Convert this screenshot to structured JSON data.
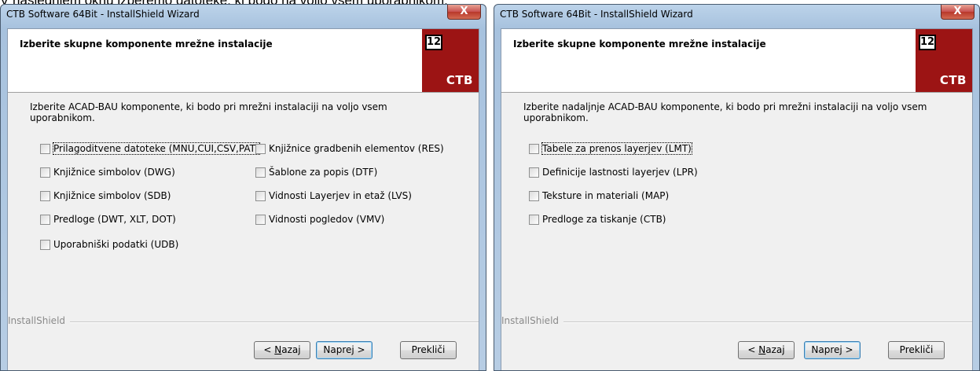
{
  "caption": "V naslednjem oknu izberemo datoteke, ki bodo na voljo vsem uporabnikom.",
  "windows": [
    {
      "title": "CTB Software 64Bit - InstallShield Wizard",
      "close_glyph": "X",
      "header_title": "Izberite skupne komponente mrežne instalacije",
      "logo_number": "12",
      "logo_text": "CTB",
      "description": "Izberite ACAD-BAU komponente, ki bodo pri mrežni instalaciji na voljo vsem uporabnikom.",
      "checkboxes": [
        {
          "label": "Prilagoditvene datoteke (MNU,CUI,CSV,PAT)",
          "checked": false,
          "focused": true
        },
        {
          "label": "Knjižnice simbolov (DWG)",
          "checked": false
        },
        {
          "label": "Knjižnice simbolov (SDB)",
          "checked": false
        },
        {
          "label": "Predloge (DWT, XLT, DOT)",
          "checked": false
        },
        {
          "label": "Uporabniški podatki (UDB)",
          "checked": false
        },
        {
          "label": "Knjižnice gradbenih elementov (RES)",
          "checked": false
        },
        {
          "label": "Šablone za popis (DTF)",
          "checked": false
        },
        {
          "label": "Vidnosti Layerjev in etaž (LVS)",
          "checked": false
        },
        {
          "label": "Vidnosti pogledov (VMV)",
          "checked": false
        }
      ],
      "group_label": "InstallShield",
      "buttons": {
        "back": "< Nazaj",
        "next": "Naprej >",
        "cancel": "Prekliči"
      }
    },
    {
      "title": "CTB Software 64Bit - InstallShield Wizard",
      "close_glyph": "X",
      "header_title": "Izberite skupne komponente mrežne instalacije",
      "logo_number": "12",
      "logo_text": "CTB",
      "description": "Izberite nadaljnje ACAD-BAU komponente, ki bodo pri mrežni instalaciji na voljo vsem uporabnikom.",
      "checkboxes": [
        {
          "label": "Tabele za prenos layerjev (LMT)",
          "checked": false,
          "focused": true
        },
        {
          "label": "Definicije lastnosti layerjev (LPR)",
          "checked": false
        },
        {
          "label": "Teksture in materiali (MAP)",
          "checked": false
        },
        {
          "label": "Predloge za tiskanje (CTB)",
          "checked": false
        }
      ],
      "group_label": "InstallShield",
      "buttons": {
        "back": "< Nazaj",
        "next": "Naprej >",
        "cancel": "Prekliči"
      }
    }
  ]
}
